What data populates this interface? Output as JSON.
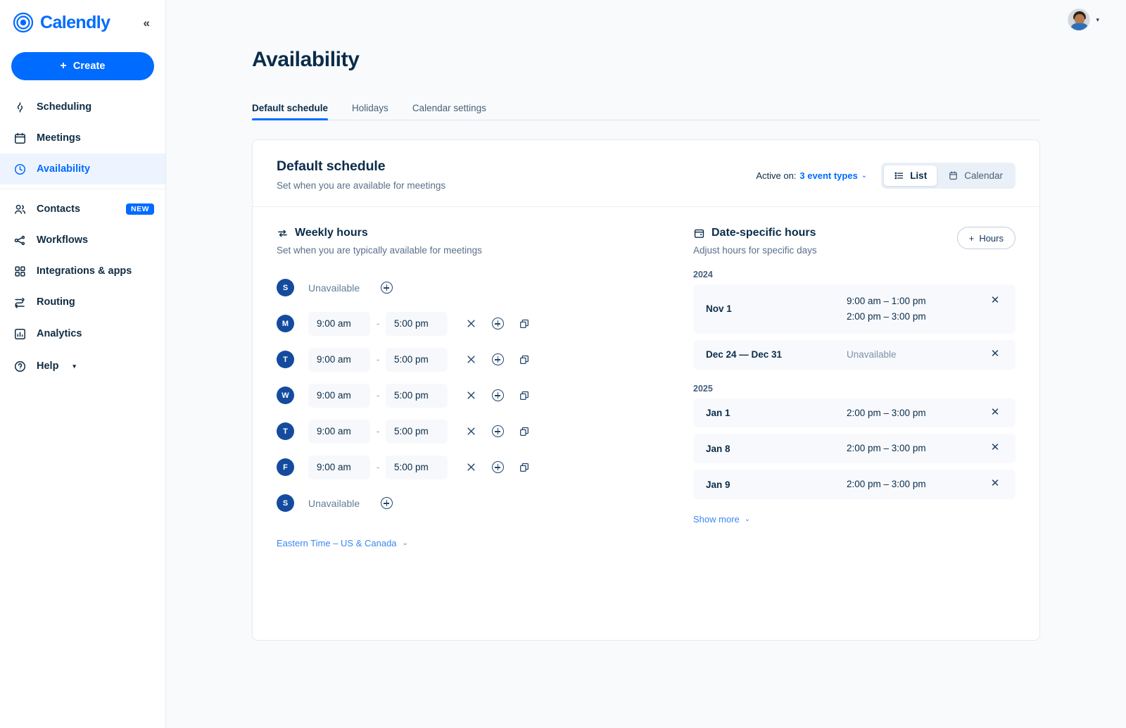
{
  "brand": {
    "name": "Calendly",
    "logo_icon": "calendly-logo-icon",
    "collapse_icon": "collapse-sidebar-icon",
    "collapse_glyph": "«"
  },
  "sidebar": {
    "create_label": "Create",
    "create_plus": "+",
    "items": [
      {
        "label": "Scheduling",
        "icon": "link-icon",
        "active": false
      },
      {
        "label": "Meetings",
        "icon": "calendar-icon",
        "active": false
      },
      {
        "label": "Availability",
        "icon": "clock-icon",
        "active": true
      }
    ],
    "items_secondary": [
      {
        "label": "Contacts",
        "icon": "people-icon",
        "badge": "NEW"
      },
      {
        "label": "Workflows",
        "icon": "workflow-icon",
        "badge": ""
      },
      {
        "label": "Integrations & apps",
        "icon": "grid-apps-icon",
        "badge": ""
      },
      {
        "label": "Routing",
        "icon": "routing-icon",
        "badge": ""
      }
    ],
    "bottom_items": [
      {
        "label": "Analytics",
        "icon": "analytics-icon",
        "caret": ""
      },
      {
        "label": "Help",
        "icon": "help-circle-icon",
        "caret": "▾"
      }
    ]
  },
  "topbar": {
    "avatar_alt": "user-avatar",
    "caret": "▾"
  },
  "page": {
    "title": "Availability",
    "tabs": [
      {
        "label": "Default schedule",
        "active": true
      },
      {
        "label": "Holidays",
        "active": false
      },
      {
        "label": "Calendar settings",
        "active": false
      }
    ]
  },
  "card": {
    "title": "Default schedule",
    "subtitle": "Set when you are available for meetings",
    "active_on_label": "Active on:",
    "active_on_value": "3 event types",
    "active_on_chevron": "⌄",
    "view_list": "List",
    "view_calendar": "Calendar",
    "view_active": "List"
  },
  "weekly": {
    "title": "Weekly hours",
    "icon": "repeat-icon",
    "subtitle": "Set when you are typically available for meetings",
    "unavailable_label": "Unavailable",
    "dash": "-",
    "rows": [
      {
        "day": "S",
        "day_full": "Sunday",
        "available": false,
        "start": "",
        "end": ""
      },
      {
        "day": "M",
        "day_full": "Monday",
        "available": true,
        "start": "9:00 am",
        "end": "5:00 pm"
      },
      {
        "day": "T",
        "day_full": "Tuesday",
        "available": true,
        "start": "9:00 am",
        "end": "5:00 pm"
      },
      {
        "day": "W",
        "day_full": "Wednesday",
        "available": true,
        "start": "9:00 am",
        "end": "5:00 pm"
      },
      {
        "day": "T",
        "day_full": "Thursday",
        "available": true,
        "start": "9:00 am",
        "end": "5:00 pm"
      },
      {
        "day": "F",
        "day_full": "Friday",
        "available": true,
        "start": "9:00 am",
        "end": "5:00 pm"
      },
      {
        "day": "S",
        "day_full": "Saturday",
        "available": false,
        "start": "",
        "end": ""
      }
    ],
    "timezone": "Eastern Time – US & Canada",
    "timezone_chevron": "⌄"
  },
  "date_specific": {
    "title": "Date-specific hours",
    "icon": "calendar-dot-icon",
    "subtitle": "Adjust hours for specific days",
    "hours_button": "Hours",
    "hours_button_plus": "+",
    "groups": [
      {
        "year": "2024",
        "rows": [
          {
            "date": "Nov 1",
            "times": [
              "9:00 am – 1:00 pm",
              "2:00 pm – 3:00 pm"
            ],
            "unavailable": false
          },
          {
            "date": "Dec 24 — Dec 31",
            "times": [
              "Unavailable"
            ],
            "unavailable": true
          }
        ]
      },
      {
        "year": "2025",
        "rows": [
          {
            "date": "Jan 1",
            "times": [
              "2:00 pm – 3:00 pm"
            ],
            "unavailable": false
          },
          {
            "date": "Jan 8",
            "times": [
              "2:00 pm – 3:00 pm"
            ],
            "unavailable": false
          },
          {
            "date": "Jan 9",
            "times": [
              "2:00 pm – 3:00 pm"
            ],
            "unavailable": false
          }
        ]
      }
    ],
    "show_more": "Show more",
    "show_more_chevron": "⌄",
    "remove_glyph": "✕"
  },
  "colors": {
    "accent": "#006bff",
    "title": "#0b2c4a",
    "muted": "#5a7089",
    "day_chip": "#144b9e",
    "page_bg": "#f8fafc",
    "row_bg": "#f7f9fc"
  }
}
